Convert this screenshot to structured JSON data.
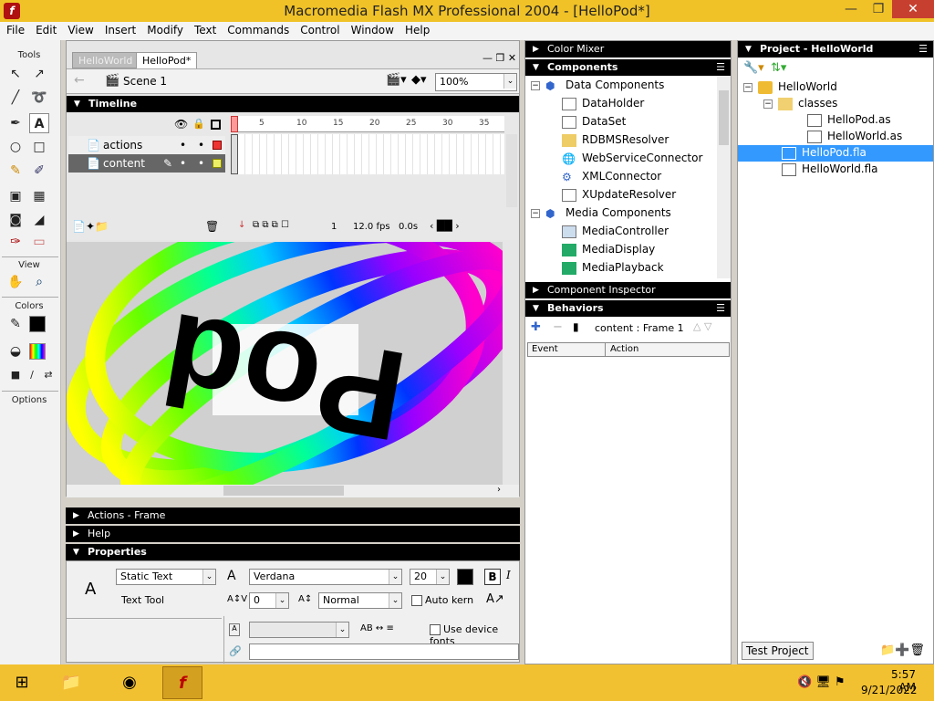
{
  "window": {
    "title": "Macromedia Flash MX Professional 2004 - [HelloPod*]",
    "app_icon": "f"
  },
  "menu": [
    "File",
    "Edit",
    "View",
    "Insert",
    "Modify",
    "Text",
    "Commands",
    "Control",
    "Window",
    "Help"
  ],
  "tools": {
    "label": "Tools",
    "view_label": "View",
    "colors_label": "Colors",
    "options_label": "Options"
  },
  "doc": {
    "tabs": [
      "HelloWorld",
      "HelloPod*"
    ],
    "scene": "Scene 1",
    "zoom": "100%",
    "timeline_title": "Timeline",
    "frame_numbers": [
      "1",
      "5",
      "10",
      "15",
      "20",
      "25",
      "30",
      "35"
    ],
    "layers": [
      "actions",
      "content"
    ],
    "current_frame": "1",
    "fps": "12.0 fps",
    "time": "0.0s",
    "stage_text": "Pod"
  },
  "panels": {
    "actions_frame": "Actions - Frame",
    "help": "Help",
    "properties": "Properties",
    "color_mixer": "Color Mixer",
    "components": "Components",
    "component_inspector": "Component Inspector",
    "behaviors": "Behaviors",
    "project": "Project - HelloWorld"
  },
  "properties": {
    "text_type": "Static Text",
    "tool_name": "Text Tool",
    "font": "Verdana",
    "size": "20",
    "spacing": "0",
    "position": "Normal",
    "auto_kern": "Auto kern",
    "device_fonts": "Use device fonts"
  },
  "components": {
    "groups": [
      {
        "name": "Data Components",
        "items": [
          "DataHolder",
          "DataSet",
          "RDBMSResolver",
          "WebServiceConnector",
          "XMLConnector",
          "XUpdateResolver"
        ]
      },
      {
        "name": "Media Components",
        "items": [
          "MediaController",
          "MediaDisplay",
          "MediaPlayback"
        ]
      }
    ]
  },
  "behaviors": {
    "target": "content : Frame 1",
    "col_event": "Event",
    "col_action": "Action"
  },
  "project": {
    "root": "HelloWorld",
    "folder": "classes",
    "files_in_folder": [
      "HelloPod.as",
      "HelloWorld.as"
    ],
    "files": [
      "HelloPod.fla",
      "HelloWorld.fla"
    ],
    "selected": "HelloPod.fla",
    "test_button": "Test Project"
  },
  "taskbar": {
    "time": "5:57 AM",
    "date": "9/21/2022"
  },
  "colors": {
    "titlebar": "#f0c228",
    "taskbar": "#f2c132",
    "selection": "#3399ff",
    "panel_header": "#000000"
  }
}
